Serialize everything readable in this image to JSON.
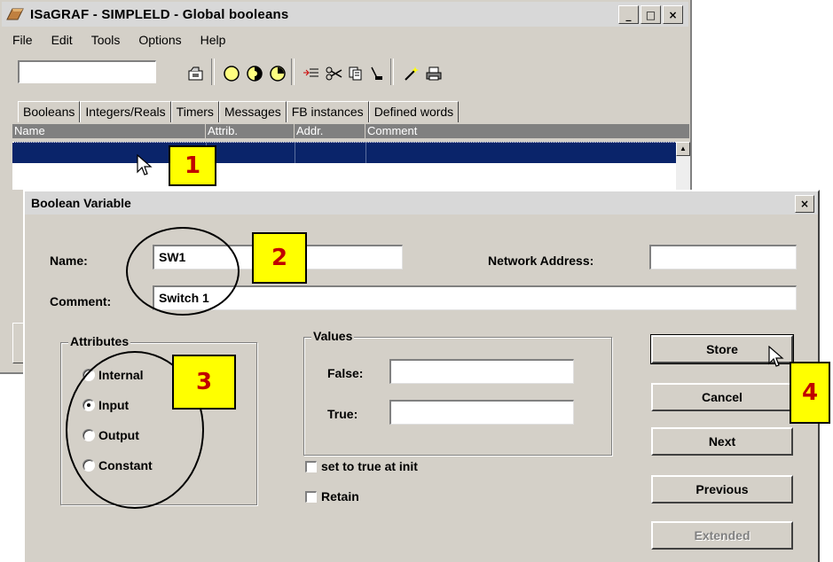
{
  "main_window": {
    "title": "ISaGRAF - SIMPLELD - Global booleans",
    "controls": {
      "minimize": "_",
      "maximize": "□",
      "close": "×"
    },
    "menu": [
      "File",
      "Edit",
      "Tools",
      "Options",
      "Help"
    ],
    "toolbar_icons": [
      "open-folder-icon",
      "circle-empty-icon",
      "circle-half-icon",
      "circle-clock-icon",
      "list-insert-icon",
      "scissors-icon",
      "copy-icon",
      "paste-icon",
      "wand-icon",
      "printer-icon"
    ],
    "tabs": [
      "Booleans",
      "Integers/Reals",
      "Timers",
      "Messages",
      "FB instances",
      "Defined words"
    ],
    "columns": [
      "Name",
      "Attrib.",
      "Addr.",
      "Comment"
    ]
  },
  "dialog": {
    "title": "Boolean Variable",
    "close": "×",
    "name_label": "Name:",
    "name_value": "SW1",
    "network_address_label": "Network Address:",
    "network_address_value": "",
    "comment_label": "Comment:",
    "comment_value": "Switch 1",
    "attributes": {
      "title": "Attributes",
      "options": [
        "Internal",
        "Input",
        "Output",
        "Constant"
      ],
      "selected": "Input"
    },
    "values": {
      "title": "Values",
      "false_label": "False:",
      "true_label": "True:",
      "false_value": "",
      "true_value": ""
    },
    "set_true_init_label": "set to true at init",
    "retain_label": "Retain",
    "buttons": {
      "store": "Store",
      "cancel": "Cancel",
      "next": "Next",
      "previous": "Previous",
      "extended": "Extended"
    }
  },
  "callouts": [
    "1",
    "2",
    "3",
    "4"
  ],
  "colors": {
    "window_bg": "#d4d0c8",
    "selection": "#0a246a",
    "badge_bg": "#ffff00",
    "badge_text": "#c00000"
  }
}
